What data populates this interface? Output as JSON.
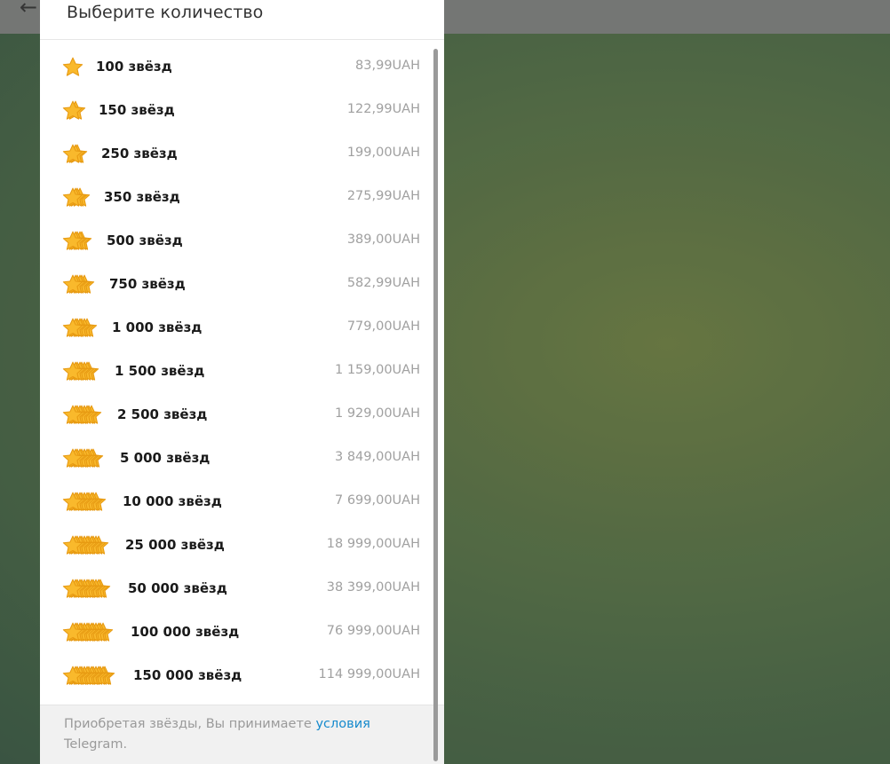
{
  "header": {
    "title": "Выберите количество",
    "back_icon": "arrow-left-icon"
  },
  "colors": {
    "star": "#f9b92c",
    "star_edge": "#e79a12",
    "link": "#168acd"
  },
  "options": [
    {
      "label": "100 звёзд",
      "price": "83,99UAH",
      "stack": 1
    },
    {
      "label": "150 звёзд",
      "price": "122,99UAH",
      "stack": 2
    },
    {
      "label": "250 звёзд",
      "price": "199,00UAH",
      "stack": 3
    },
    {
      "label": "350 звёзд",
      "price": "275,99UAH",
      "stack": 4
    },
    {
      "label": "500 звёзд",
      "price": "389,00UAH",
      "stack": 5
    },
    {
      "label": "750 звёзд",
      "price": "582,99UAH",
      "stack": 6
    },
    {
      "label": "1 000 звёзд",
      "price": "779,00UAH",
      "stack": 7
    },
    {
      "label": "1 500 звёзд",
      "price": "1 159,00UAH",
      "stack": 8
    },
    {
      "label": "2 500 звёзд",
      "price": "1 929,00UAH",
      "stack": 9
    },
    {
      "label": "5 000 звёзд",
      "price": "3 849,00UAH",
      "stack": 10
    },
    {
      "label": "10 000 звёзд",
      "price": "7 699,00UAH",
      "stack": 11
    },
    {
      "label": "25 000 звёзд",
      "price": "18 999,00UAH",
      "stack": 12
    },
    {
      "label": "50 000 звёзд",
      "price": "38 399,00UAH",
      "stack": 13
    },
    {
      "label": "100 000 звёзд",
      "price": "76 999,00UAH",
      "stack": 14
    },
    {
      "label": "150 000 звёзд",
      "price": "114 999,00UAH",
      "stack": 15
    }
  ],
  "footer": {
    "text": "Приобретая звёзды, Вы принимаете ",
    "link": "условия",
    "text2": "Telegram."
  }
}
